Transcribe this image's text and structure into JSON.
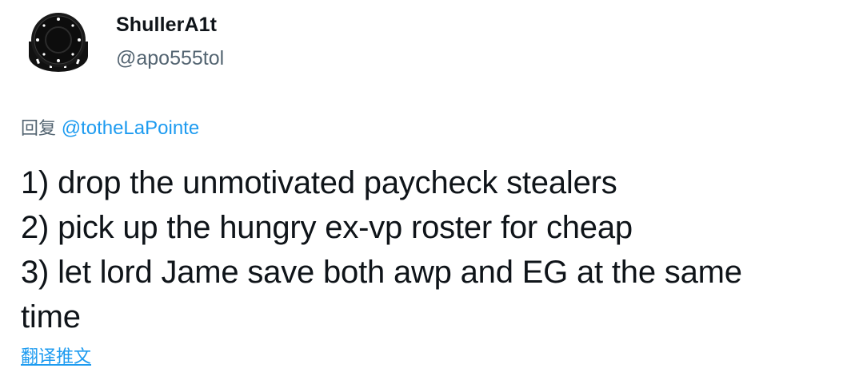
{
  "author": {
    "display_name": "ShullerA1t",
    "handle": "@apo555tol",
    "avatar": "poker-chip-avatar"
  },
  "reply": {
    "prefix": "回复",
    "mention": "@totheLaPointe"
  },
  "tweet": {
    "lines": [
      "1) drop the unmotivated paycheck stealers",
      "2) pick up the hungry ex-vp roster for cheap",
      "3) let lord Jame save both awp and EG at the same",
      "time"
    ]
  },
  "actions": {
    "translate_label": "翻译推文"
  },
  "colors": {
    "text_primary": "#0f1419",
    "text_secondary": "#536471",
    "link": "#1d9bf0",
    "background": "#ffffff"
  }
}
